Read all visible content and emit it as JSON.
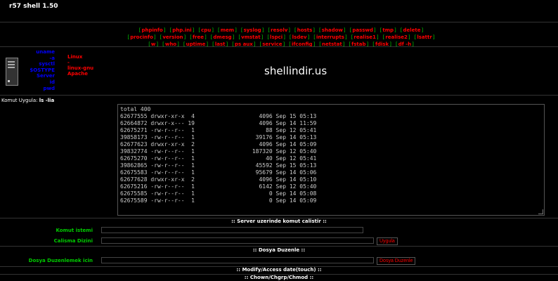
{
  "app": {
    "title": "r57 shell 1.50"
  },
  "nav": {
    "row1": [
      "phpinfo",
      "php.ini",
      "cpu",
      "mem",
      "syslog",
      "resolv",
      "hosts",
      "shadow",
      "passwd",
      "tmp",
      "delete"
    ],
    "row2": [
      "procinfo",
      "version",
      "free",
      "dmesg",
      "vmstat",
      "lspci",
      "lsdev",
      "interrupts",
      "realise1",
      "realise2",
      "lsattr"
    ],
    "row3": [
      "w",
      "who",
      "uptime",
      "last",
      "ps aux",
      "service",
      "ifconfig",
      "netstat",
      "fstab",
      "fdisk",
      "df -h"
    ]
  },
  "info": {
    "labels": [
      "uname",
      "-a",
      "sysctl",
      "$OSTYPE",
      "Server",
      "id",
      "pwd"
    ],
    "values": [
      "Linux",
      "-",
      "linux-gnu",
      "Apache"
    ]
  },
  "watermark": "shellindir.us",
  "command": {
    "label": "Komut Uygula:",
    "value": "ls -lia"
  },
  "output": [
    "total 400",
    "62677555 drwxr-xr-x  4                   4096 Sep 15 05:13",
    "62664872 drwxr-x--- 19                   4096 Sep 14 11:59",
    "62675271 -rw-r--r--  1                     88 Sep 12 05:41",
    "39858173 -rw-r--r--  1                  39176 Sep 14 05:13",
    "62677623 drwxr-xr-x  2                   4096 Sep 14 05:09",
    "39832774 -rw-r--r--  1                 187320 Sep 12 05:40",
    "62675270 -rw-r--r--  1                     40 Sep 12 05:41",
    "39862865 -rw-r--r--  1                  45592 Sep 15 05:13",
    "62675583 -rw-r--r--  1                  95679 Sep 14 05:06",
    "62677628 drwxr-xr-x  2                   4096 Sep 14 05:10",
    "62675216 -rw-r--r--  1                   6142 Sep 12 05:40",
    "62675585 -rw-r--r--  1                      0 Sep 14 05:08",
    "62675589 -rw-r--r--  1                      0 Sep 14 05:09"
  ],
  "server_cmd": {
    "header": ":: Server uzerinde komut calistir ::",
    "cmd_label": "Komut istemi",
    "dir_label": "Calisma Dizini",
    "button": "Uygula"
  },
  "file_edit": {
    "header": ":: Dosya Duzenle ::",
    "label": "Dosya Duzenlemek icin",
    "button": "Dosya Duzenle"
  },
  "modify": {
    "header": ":: Modify/Access date(touch) ::"
  },
  "chown": {
    "header": ":: Chown/Chgrp/Chmod ::"
  }
}
